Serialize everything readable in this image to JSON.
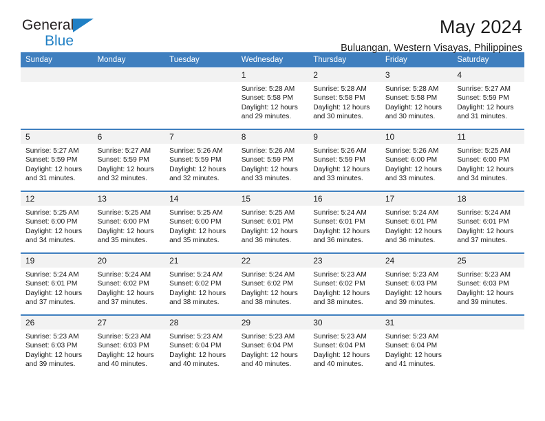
{
  "brand": {
    "name_dark": "General",
    "name_blue": "Blue",
    "triangle_color": "#1f7fc4"
  },
  "header": {
    "title": "May 2024",
    "subtitle": "Buluangan, Western Visayas, Philippines"
  },
  "theme": {
    "header_bg": "#3f7fbf",
    "daynum_bg": "#f2f2f2",
    "text": "#1a1a1a"
  },
  "weekday_headers": [
    "Sunday",
    "Monday",
    "Tuesday",
    "Wednesday",
    "Thursday",
    "Friday",
    "Saturday"
  ],
  "weeks": [
    [
      {
        "day": "",
        "sunrise": "",
        "sunset": "",
        "daylight_1": "",
        "daylight_2": ""
      },
      {
        "day": "",
        "sunrise": "",
        "sunset": "",
        "daylight_1": "",
        "daylight_2": ""
      },
      {
        "day": "",
        "sunrise": "",
        "sunset": "",
        "daylight_1": "",
        "daylight_2": ""
      },
      {
        "day": "1",
        "sunrise": "Sunrise: 5:28 AM",
        "sunset": "Sunset: 5:58 PM",
        "daylight_1": "Daylight: 12 hours",
        "daylight_2": "and 29 minutes."
      },
      {
        "day": "2",
        "sunrise": "Sunrise: 5:28 AM",
        "sunset": "Sunset: 5:58 PM",
        "daylight_1": "Daylight: 12 hours",
        "daylight_2": "and 30 minutes."
      },
      {
        "day": "3",
        "sunrise": "Sunrise: 5:28 AM",
        "sunset": "Sunset: 5:58 PM",
        "daylight_1": "Daylight: 12 hours",
        "daylight_2": "and 30 minutes."
      },
      {
        "day": "4",
        "sunrise": "Sunrise: 5:27 AM",
        "sunset": "Sunset: 5:59 PM",
        "daylight_1": "Daylight: 12 hours",
        "daylight_2": "and 31 minutes."
      }
    ],
    [
      {
        "day": "5",
        "sunrise": "Sunrise: 5:27 AM",
        "sunset": "Sunset: 5:59 PM",
        "daylight_1": "Daylight: 12 hours",
        "daylight_2": "and 31 minutes."
      },
      {
        "day": "6",
        "sunrise": "Sunrise: 5:27 AM",
        "sunset": "Sunset: 5:59 PM",
        "daylight_1": "Daylight: 12 hours",
        "daylight_2": "and 32 minutes."
      },
      {
        "day": "7",
        "sunrise": "Sunrise: 5:26 AM",
        "sunset": "Sunset: 5:59 PM",
        "daylight_1": "Daylight: 12 hours",
        "daylight_2": "and 32 minutes."
      },
      {
        "day": "8",
        "sunrise": "Sunrise: 5:26 AM",
        "sunset": "Sunset: 5:59 PM",
        "daylight_1": "Daylight: 12 hours",
        "daylight_2": "and 33 minutes."
      },
      {
        "day": "9",
        "sunrise": "Sunrise: 5:26 AM",
        "sunset": "Sunset: 5:59 PM",
        "daylight_1": "Daylight: 12 hours",
        "daylight_2": "and 33 minutes."
      },
      {
        "day": "10",
        "sunrise": "Sunrise: 5:26 AM",
        "sunset": "Sunset: 6:00 PM",
        "daylight_1": "Daylight: 12 hours",
        "daylight_2": "and 33 minutes."
      },
      {
        "day": "11",
        "sunrise": "Sunrise: 5:25 AM",
        "sunset": "Sunset: 6:00 PM",
        "daylight_1": "Daylight: 12 hours",
        "daylight_2": "and 34 minutes."
      }
    ],
    [
      {
        "day": "12",
        "sunrise": "Sunrise: 5:25 AM",
        "sunset": "Sunset: 6:00 PM",
        "daylight_1": "Daylight: 12 hours",
        "daylight_2": "and 34 minutes."
      },
      {
        "day": "13",
        "sunrise": "Sunrise: 5:25 AM",
        "sunset": "Sunset: 6:00 PM",
        "daylight_1": "Daylight: 12 hours",
        "daylight_2": "and 35 minutes."
      },
      {
        "day": "14",
        "sunrise": "Sunrise: 5:25 AM",
        "sunset": "Sunset: 6:00 PM",
        "daylight_1": "Daylight: 12 hours",
        "daylight_2": "and 35 minutes."
      },
      {
        "day": "15",
        "sunrise": "Sunrise: 5:25 AM",
        "sunset": "Sunset: 6:01 PM",
        "daylight_1": "Daylight: 12 hours",
        "daylight_2": "and 36 minutes."
      },
      {
        "day": "16",
        "sunrise": "Sunrise: 5:24 AM",
        "sunset": "Sunset: 6:01 PM",
        "daylight_1": "Daylight: 12 hours",
        "daylight_2": "and 36 minutes."
      },
      {
        "day": "17",
        "sunrise": "Sunrise: 5:24 AM",
        "sunset": "Sunset: 6:01 PM",
        "daylight_1": "Daylight: 12 hours",
        "daylight_2": "and 36 minutes."
      },
      {
        "day": "18",
        "sunrise": "Sunrise: 5:24 AM",
        "sunset": "Sunset: 6:01 PM",
        "daylight_1": "Daylight: 12 hours",
        "daylight_2": "and 37 minutes."
      }
    ],
    [
      {
        "day": "19",
        "sunrise": "Sunrise: 5:24 AM",
        "sunset": "Sunset: 6:01 PM",
        "daylight_1": "Daylight: 12 hours",
        "daylight_2": "and 37 minutes."
      },
      {
        "day": "20",
        "sunrise": "Sunrise: 5:24 AM",
        "sunset": "Sunset: 6:02 PM",
        "daylight_1": "Daylight: 12 hours",
        "daylight_2": "and 37 minutes."
      },
      {
        "day": "21",
        "sunrise": "Sunrise: 5:24 AM",
        "sunset": "Sunset: 6:02 PM",
        "daylight_1": "Daylight: 12 hours",
        "daylight_2": "and 38 minutes."
      },
      {
        "day": "22",
        "sunrise": "Sunrise: 5:24 AM",
        "sunset": "Sunset: 6:02 PM",
        "daylight_1": "Daylight: 12 hours",
        "daylight_2": "and 38 minutes."
      },
      {
        "day": "23",
        "sunrise": "Sunrise: 5:23 AM",
        "sunset": "Sunset: 6:02 PM",
        "daylight_1": "Daylight: 12 hours",
        "daylight_2": "and 38 minutes."
      },
      {
        "day": "24",
        "sunrise": "Sunrise: 5:23 AM",
        "sunset": "Sunset: 6:03 PM",
        "daylight_1": "Daylight: 12 hours",
        "daylight_2": "and 39 minutes."
      },
      {
        "day": "25",
        "sunrise": "Sunrise: 5:23 AM",
        "sunset": "Sunset: 6:03 PM",
        "daylight_1": "Daylight: 12 hours",
        "daylight_2": "and 39 minutes."
      }
    ],
    [
      {
        "day": "26",
        "sunrise": "Sunrise: 5:23 AM",
        "sunset": "Sunset: 6:03 PM",
        "daylight_1": "Daylight: 12 hours",
        "daylight_2": "and 39 minutes."
      },
      {
        "day": "27",
        "sunrise": "Sunrise: 5:23 AM",
        "sunset": "Sunset: 6:03 PM",
        "daylight_1": "Daylight: 12 hours",
        "daylight_2": "and 40 minutes."
      },
      {
        "day": "28",
        "sunrise": "Sunrise: 5:23 AM",
        "sunset": "Sunset: 6:04 PM",
        "daylight_1": "Daylight: 12 hours",
        "daylight_2": "and 40 minutes."
      },
      {
        "day": "29",
        "sunrise": "Sunrise: 5:23 AM",
        "sunset": "Sunset: 6:04 PM",
        "daylight_1": "Daylight: 12 hours",
        "daylight_2": "and 40 minutes."
      },
      {
        "day": "30",
        "sunrise": "Sunrise: 5:23 AM",
        "sunset": "Sunset: 6:04 PM",
        "daylight_1": "Daylight: 12 hours",
        "daylight_2": "and 40 minutes."
      },
      {
        "day": "31",
        "sunrise": "Sunrise: 5:23 AM",
        "sunset": "Sunset: 6:04 PM",
        "daylight_1": "Daylight: 12 hours",
        "daylight_2": "and 41 minutes."
      },
      {
        "day": "",
        "sunrise": "",
        "sunset": "",
        "daylight_1": "",
        "daylight_2": ""
      }
    ]
  ]
}
